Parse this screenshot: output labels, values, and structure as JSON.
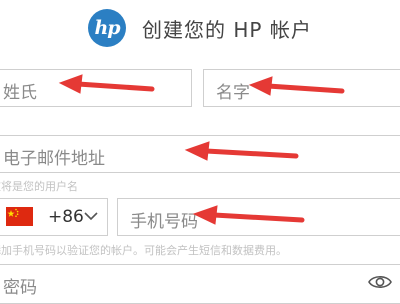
{
  "header": {
    "logo_text": "hp",
    "title": "创建您的 HP 帐户"
  },
  "form": {
    "last_name_placeholder": "姓氏",
    "first_name_placeholder": "名字",
    "email_placeholder": "电子邮件地址",
    "email_hint": "这将是您的用户名",
    "country_code": "+86",
    "phone_placeholder": "手机号码",
    "phone_hint": "添加手机号码以验证您的帐户。可能会产生短信和数据费用。",
    "password_placeholder": "密码"
  },
  "colors": {
    "brand_blue": "#2b7fc3",
    "annotation_red": "#e53935"
  },
  "icons": {
    "flag": "china-flag-icon",
    "dropdown": "chevron-down-icon",
    "password_toggle": "eye-icon"
  }
}
